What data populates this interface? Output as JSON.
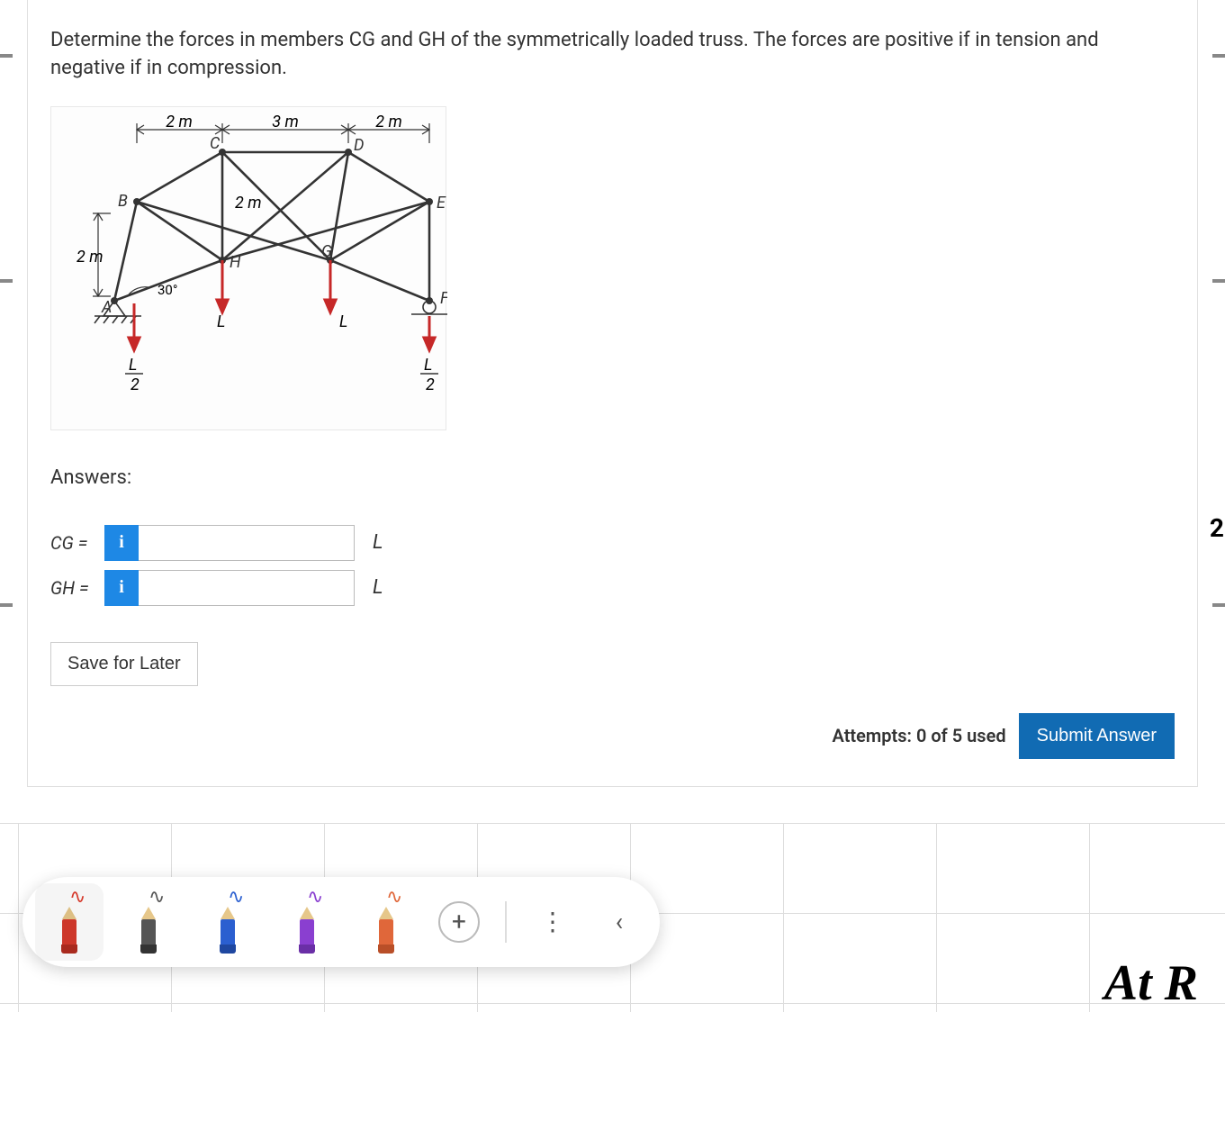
{
  "question": {
    "prompt": "Determine the forces in members CG and GH of the symmetrically loaded truss. The forces are positive if in tension and negative if in compression.",
    "answers_heading": "Answers:",
    "rows": [
      {
        "lhs": "CG =",
        "info": "i",
        "unit": "L",
        "value": ""
      },
      {
        "lhs": "GH =",
        "info": "i",
        "unit": "L",
        "value": ""
      }
    ],
    "save_label": "Save for Later",
    "attempts_text": "Attempts: 0 of 5 used",
    "submit_label": "Submit Answer",
    "side_badge": "2"
  },
  "diagram": {
    "top_dims": [
      "2 m",
      "3 m",
      "2 m"
    ],
    "left_dim": "2 m",
    "mid_dim": "2 m",
    "angle": "30°",
    "nodes": {
      "A": "A",
      "B": "B",
      "C": "C",
      "D": "D",
      "E": "E",
      "F": "F",
      "G": "G",
      "H": "H"
    },
    "loads": {
      "H": "L",
      "G": "L",
      "A": "L",
      "F": "L",
      "half": "2"
    }
  },
  "toolbar": {
    "pens": [
      {
        "name": "pen-red",
        "cls": "red selected"
      },
      {
        "name": "pen-black",
        "cls": "black"
      },
      {
        "name": "pen-blue",
        "cls": "blue"
      },
      {
        "name": "pen-purple",
        "cls": "purple"
      },
      {
        "name": "pen-orange",
        "cls": "orange"
      }
    ],
    "add": "+",
    "more": "⋮",
    "collapse": "‹"
  },
  "handwriting": "At  R"
}
